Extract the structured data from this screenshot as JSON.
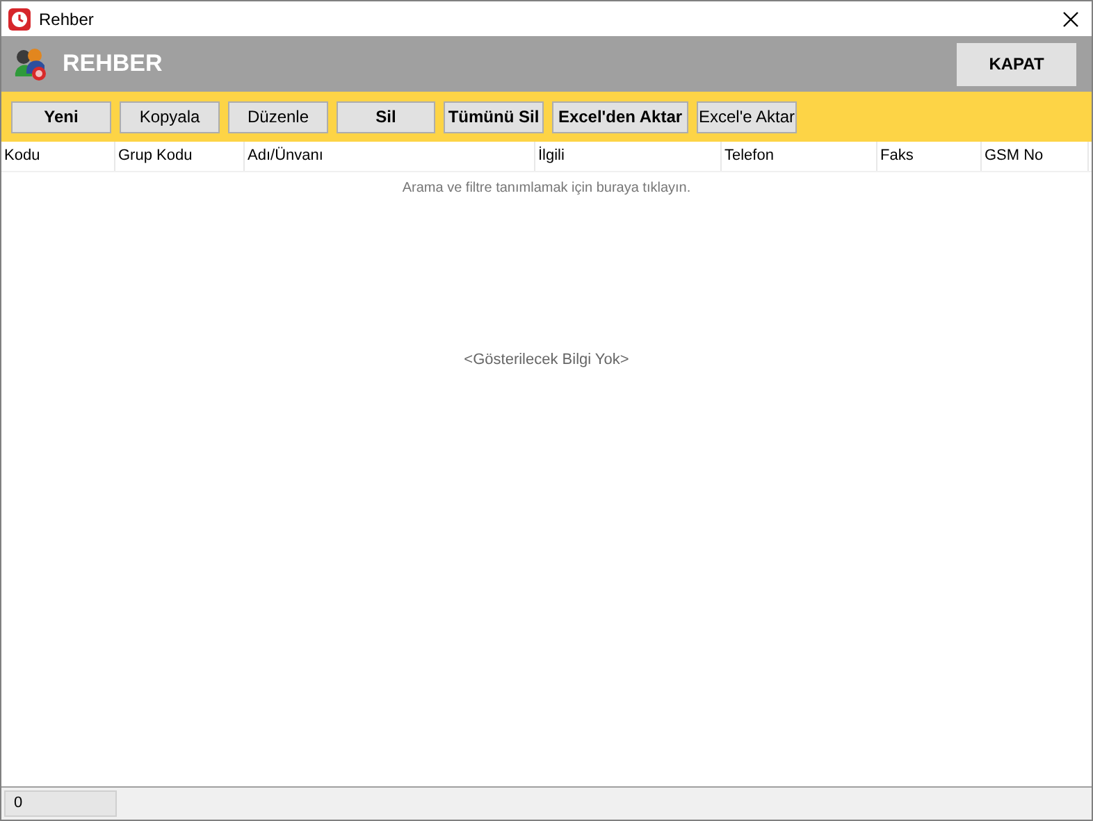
{
  "window": {
    "title": "Rehber"
  },
  "header": {
    "title": "REHBER",
    "close_button": "KAPAT"
  },
  "toolbar": [
    {
      "label": "Yeni",
      "bold": true
    },
    {
      "label": "Kopyala",
      "bold": false
    },
    {
      "label": "Düzenle",
      "bold": false
    },
    {
      "label": "Sil",
      "bold": true
    },
    {
      "label": "Tümünü Sil",
      "bold": true
    },
    {
      "label": "Excel'den Aktar",
      "bold": true
    },
    {
      "label": "Excel'e Aktar",
      "bold": false
    }
  ],
  "table": {
    "columns": [
      "Kodu",
      "Grup Kodu",
      "Adı/Ünvanı",
      "İlgili",
      "Telefon",
      "Faks",
      "GSM No"
    ],
    "filter_hint": "Arama ve filtre tanımlamak için buraya tıklayın.",
    "empty_text": "<Gösterilecek Bilgi Yok>"
  },
  "status_bar": {
    "count": "0"
  }
}
